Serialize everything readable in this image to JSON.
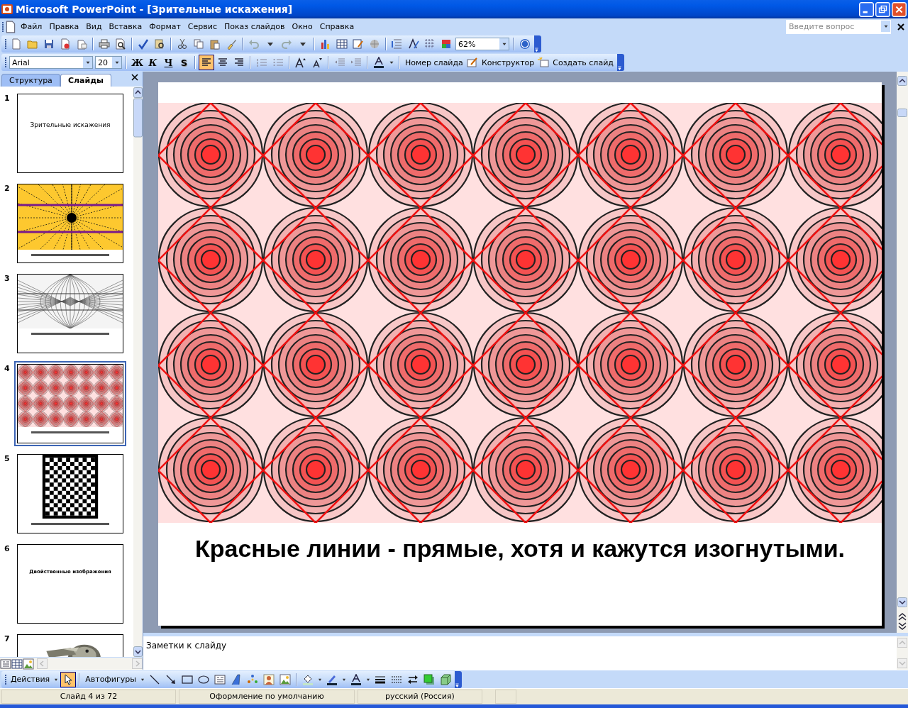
{
  "window": {
    "title": "Microsoft PowerPoint - [Зрительные искажения]"
  },
  "menu": [
    {
      "label": "Файл"
    },
    {
      "label": "Правка"
    },
    {
      "label": "Вид"
    },
    {
      "label": "Вставка"
    },
    {
      "label": "Формат"
    },
    {
      "label": "Сервис"
    },
    {
      "label": "Показ слайдов"
    },
    {
      "label": "Окно"
    },
    {
      "label": "Справка"
    }
  ],
  "help_box": {
    "placeholder": "Введите вопрос"
  },
  "standard_toolbar": {
    "zoom": "62%"
  },
  "formatting_toolbar": {
    "font": "Arial",
    "size": "20",
    "styles": [
      {
        "label": "Ж",
        "kind": "bold"
      },
      {
        "label": "К",
        "kind": "italic"
      },
      {
        "label": "Ч",
        "kind": "underline"
      },
      {
        "label": "S",
        "kind": "shadow"
      }
    ],
    "align": [
      {
        "kind": "left",
        "selected": true
      },
      {
        "kind": "center",
        "selected": false
      },
      {
        "kind": "right",
        "selected": false
      }
    ],
    "commands": [
      {
        "label": "Номер слайда",
        "kind": "plain"
      },
      {
        "label": "Конструктор",
        "kind": "design"
      },
      {
        "label": "Создать слайд",
        "kind": "new"
      }
    ]
  },
  "pane_tabs": [
    {
      "label": "Структура",
      "selected": false
    },
    {
      "label": "Слайды",
      "selected": true
    }
  ],
  "slides": [
    {
      "number": "1",
      "kind": "title",
      "title": "Зрительные искажения",
      "selected": false
    },
    {
      "number": "2",
      "kind": "rays",
      "selected": false
    },
    {
      "number": "3",
      "kind": "lines",
      "selected": false
    },
    {
      "number": "4",
      "kind": "circles",
      "selected": true
    },
    {
      "number": "5",
      "kind": "checker",
      "selected": false
    },
    {
      "number": "6",
      "kind": "title",
      "title": "Двойственные изображения",
      "selected": false
    },
    {
      "number": "7",
      "kind": "picture",
      "selected": false
    }
  ],
  "current_slide": {
    "caption": "Красные линии - прямые, хотя и кажутся изогнутыми."
  },
  "notes": {
    "placeholder": "Заметки к слайду"
  },
  "drawing_toolbar": {
    "actions": "Действия",
    "autoshapes": "Автофигуры",
    "pointer_selected": true
  },
  "status_bar": [
    "Слайд 4 из 72",
    "Оформление по умолчанию",
    "русский (Россия)"
  ]
}
